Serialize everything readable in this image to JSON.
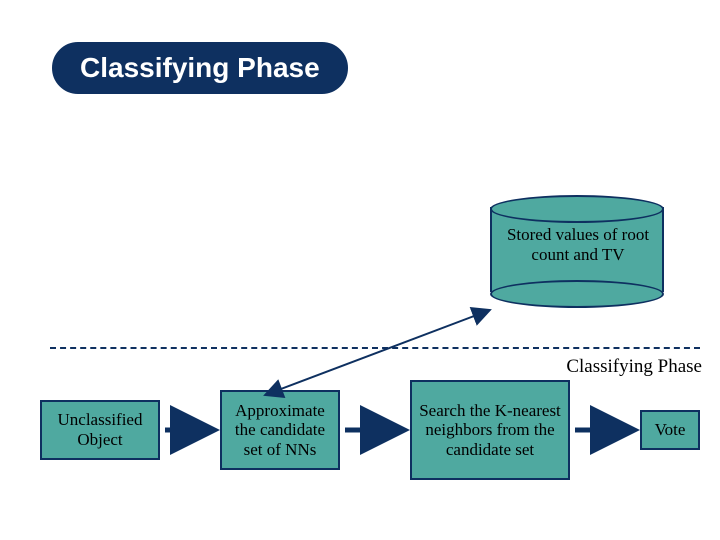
{
  "title": "Classifying Phase",
  "cylinder_label": "Stored values of root count and TV",
  "phase_label": "Classifying Phase",
  "boxes": {
    "unclassified": "Unclassified Object",
    "approximate": "Approximate the candidate set of NNs",
    "search": "Search the K-nearest neighbors from the candidate set",
    "vote": "Vote"
  }
}
